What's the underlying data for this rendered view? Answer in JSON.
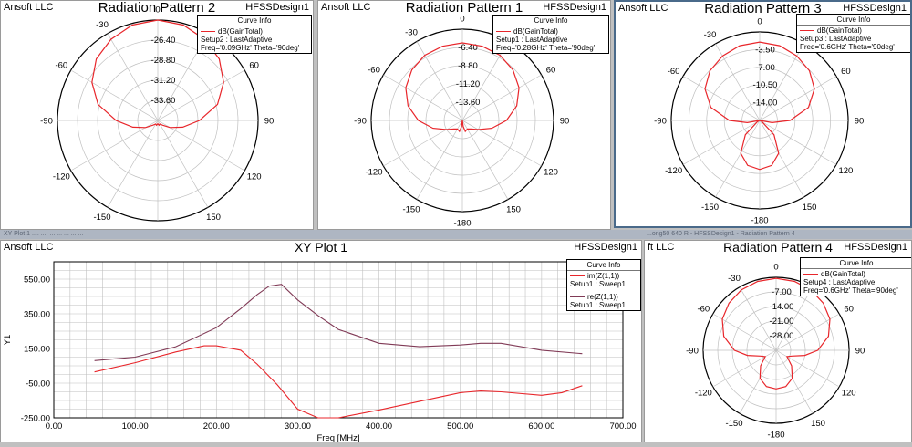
{
  "vendor": "Ansoft LLC",
  "vendor_cut": "ft LLC",
  "design": "HFSSDesign1",
  "legend_title": "Curve Info",
  "status_strips": {
    "left": "XY Plot 1 .... .... ... ... ... ... ...",
    "right": "...ong50 640 R - HFSSDesign1 - Radiation Pattern 4"
  },
  "colors": {
    "red": "#e8262b",
    "maroon": "#803a56",
    "grid": "#c0c0c0",
    "frame": "#4a6a8a"
  },
  "chart_data": [
    {
      "id": "rp2",
      "type": "polar",
      "title": "Radiation Pattern 2",
      "angle_labels": [
        "0",
        "30",
        "60",
        "90",
        "120",
        "150",
        "-180",
        "-150",
        "-120",
        "-90",
        "-60",
        "-30"
      ],
      "radial_labels": [
        "-26.40",
        "-28.80",
        "-31.20",
        "-33.60"
      ],
      "rlim": [
        -36.0,
        -24.0
      ],
      "series": [
        {
          "legend": [
            "dB(GainTotal)",
            "Setup2 : LastAdaptive",
            "Freq='0.09GHz' Theta='90deg'"
          ],
          "theta": [
            0,
            15,
            30,
            45,
            60,
            75,
            90,
            105,
            120,
            135,
            150,
            165,
            180,
            195,
            210,
            225,
            240,
            255,
            270,
            285,
            300,
            315,
            330,
            345
          ],
          "values": [
            -24.0,
            -24.2,
            -24.8,
            -25.6,
            -26.9,
            -28.6,
            -31.0,
            -32.9,
            -34.3,
            -35.2,
            -35.5,
            -35.4,
            -35.6,
            -35.4,
            -35.5,
            -35.2,
            -34.3,
            -32.9,
            -31.0,
            -28.6,
            -26.9,
            -25.6,
            -24.8,
            -24.2
          ]
        }
      ]
    },
    {
      "id": "rp1",
      "type": "polar",
      "title": "Radiation Pattern 1",
      "angle_labels": [
        "0",
        "30",
        "60",
        "90",
        "120",
        "150",
        "-180",
        "-150",
        "-120",
        "-90",
        "-60",
        "-30"
      ],
      "radial_labels": [
        "-6.40",
        "-8.80",
        "-11.20",
        "-13.60"
      ],
      "rlim": [
        -16.0,
        -4.0
      ],
      "series": [
        {
          "legend": [
            "dB(GainTotal)",
            "Setup1 : LastAdaptive",
            "Freq='0.28GHz' Theta='90deg'"
          ],
          "theta": [
            0,
            15,
            30,
            45,
            60,
            75,
            90,
            105,
            120,
            135,
            150,
            165,
            172,
            180,
            188,
            195,
            210,
            225,
            240,
            255,
            270,
            285,
            300,
            315,
            330,
            345
          ],
          "values": [
            -5.8,
            -5.9,
            -6.1,
            -6.6,
            -7.4,
            -8.6,
            -10.2,
            -12.0,
            -13.6,
            -14.4,
            -14.7,
            -14.5,
            -15.2,
            -16.0,
            -15.2,
            -14.5,
            -14.7,
            -14.4,
            -13.6,
            -12.0,
            -10.2,
            -8.6,
            -7.4,
            -6.6,
            -6.1,
            -5.9
          ]
        }
      ]
    },
    {
      "id": "rp3",
      "type": "polar",
      "title": "Radiation Pattern 3",
      "angle_labels": [
        "0",
        "30",
        "60",
        "90",
        "120",
        "150",
        "-180",
        "-150",
        "-120",
        "-90",
        "-60",
        "-30"
      ],
      "radial_labels": [
        "-3.50",
        "-7.00",
        "-10.50",
        "-14.00"
      ],
      "rlim": [
        -17.5,
        0.0
      ],
      "series": [
        {
          "legend": [
            "dB(GainTotal)",
            "Setup3 : LastAdaptive",
            "Freq='0.6GHz' Theta='90deg'"
          ],
          "theta": [
            0,
            15,
            30,
            45,
            60,
            75,
            90,
            100,
            110,
            120,
            135,
            150,
            165,
            180,
            195,
            210,
            225,
            240,
            250,
            260,
            270,
            285,
            300,
            315,
            330,
            345
          ],
          "values": [
            -2.0,
            -2.2,
            -2.8,
            -3.6,
            -5.0,
            -7.5,
            -11.5,
            -15.0,
            -17.5,
            -17.0,
            -13.5,
            -10.0,
            -8.3,
            -7.8,
            -8.3,
            -10.0,
            -13.5,
            -17.0,
            -17.5,
            -15.0,
            -11.5,
            -7.5,
            -5.0,
            -3.6,
            -2.8,
            -2.2
          ]
        }
      ]
    },
    {
      "id": "rp4",
      "type": "polar",
      "title": "Radiation Pattern 4",
      "angle_labels": [
        "0",
        "30",
        "60",
        "90",
        "120",
        "150",
        "-180",
        "-150",
        "-120",
        "-90",
        "-60",
        "-30"
      ],
      "radial_labels": [
        "-7.00",
        "-14.00",
        "-21.00",
        "-28.00"
      ],
      "rlim": [
        -35.0,
        0.0
      ],
      "series": [
        {
          "legend": [
            "dB(GainTotal)",
            "Setup4 : LastAdaptive",
            "Freq='0.6GHz' Theta='90deg'"
          ],
          "theta": [
            0,
            15,
            30,
            45,
            60,
            75,
            90,
            100,
            110,
            120,
            135,
            150,
            165,
            180,
            195,
            210,
            225,
            240,
            250,
            260,
            270,
            285,
            300,
            315,
            330,
            345
          ],
          "values": [
            -0.5,
            -0.8,
            -1.6,
            -3.0,
            -5.2,
            -9.0,
            -15.0,
            -21.0,
            -27.0,
            -29.0,
            -24.5,
            -19.5,
            -17.0,
            -16.5,
            -17.0,
            -19.5,
            -24.5,
            -29.0,
            -27.0,
            -21.0,
            -15.0,
            -9.0,
            -5.2,
            -3.0,
            -1.6,
            -0.8
          ]
        }
      ]
    },
    {
      "id": "xy1",
      "type": "line",
      "title": "XY Plot 1",
      "xlabel": "Freq [MHz]",
      "ylabel": "Y1",
      "xlim": [
        0,
        700
      ],
      "ylim": [
        -250,
        650
      ],
      "x_ticks": [
        "0.00",
        "100.00",
        "200.00",
        "300.00",
        "400.00",
        "500.00",
        "600.00",
        "700.00"
      ],
      "y_ticks": [
        "-250.00",
        "-50.00",
        "150.00",
        "350.00",
        "550.00"
      ],
      "series": [
        {
          "legend": [
            "im(Z(1,1))",
            "Setup1 : Sweep1"
          ],
          "color": "#e8262b",
          "x": [
            50,
            100,
            150,
            185,
            200,
            230,
            250,
            275,
            300,
            325,
            350,
            400,
            450,
            500,
            525,
            550,
            600,
            625,
            650
          ],
          "y": [
            15,
            68,
            130,
            165,
            165,
            140,
            60,
            -60,
            -200,
            -250,
            -250,
            -205,
            -155,
            -105,
            -95,
            -100,
            -120,
            -105,
            -65
          ]
        },
        {
          "legend": [
            "re(Z(1,1))",
            "Setup1 : Sweep1"
          ],
          "color": "#803a56",
          "x": [
            50,
            100,
            150,
            200,
            230,
            250,
            265,
            280,
            300,
            325,
            350,
            400,
            450,
            500,
            525,
            550,
            600,
            650
          ],
          "y": [
            80,
            100,
            160,
            270,
            380,
            460,
            510,
            520,
            430,
            340,
            260,
            180,
            160,
            170,
            180,
            180,
            140,
            120
          ]
        }
      ]
    }
  ]
}
